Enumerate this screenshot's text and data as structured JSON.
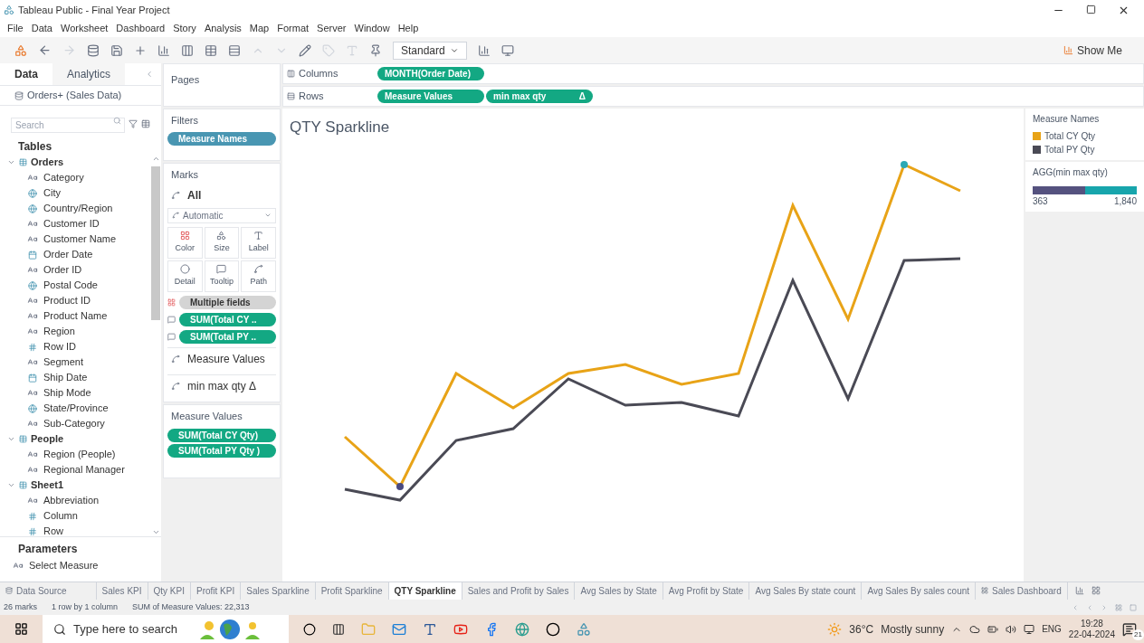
{
  "window": {
    "title": "Tableau Public - Final Year Project"
  },
  "menu": [
    "File",
    "Data",
    "Worksheet",
    "Dashboard",
    "Story",
    "Analysis",
    "Map",
    "Format",
    "Server",
    "Window",
    "Help"
  ],
  "toolbar": {
    "fit": "Standard",
    "show_me": "Show Me"
  },
  "side_tabs": [
    {
      "label": "Data",
      "selected": true
    },
    {
      "label": "Analytics",
      "selected": false
    }
  ],
  "data_source": "Orders+ (Sales Data)",
  "search": {
    "placeholder": "Search"
  },
  "tables_heading": "Tables",
  "tables": [
    {
      "name": "Orders",
      "expanded": true,
      "children": [
        {
          "name": "Category",
          "kind": "text"
        },
        {
          "name": "City",
          "kind": "geo"
        },
        {
          "name": "Country/Region",
          "kind": "geo"
        },
        {
          "name": "Customer ID",
          "kind": "text"
        },
        {
          "name": "Customer Name",
          "kind": "text"
        },
        {
          "name": "Order Date",
          "kind": "date"
        },
        {
          "name": "Order ID",
          "kind": "text"
        },
        {
          "name": "Postal Code",
          "kind": "geo"
        },
        {
          "name": "Product ID",
          "kind": "text"
        },
        {
          "name": "Product Name",
          "kind": "text"
        },
        {
          "name": "Region",
          "kind": "text"
        },
        {
          "name": "Row ID",
          "kind": "number"
        },
        {
          "name": "Segment",
          "kind": "text"
        },
        {
          "name": "Ship Date",
          "kind": "date"
        },
        {
          "name": "Ship Mode",
          "kind": "text"
        },
        {
          "name": "State/Province",
          "kind": "geo"
        },
        {
          "name": "Sub-Category",
          "kind": "text"
        }
      ]
    },
    {
      "name": "People",
      "expanded": true,
      "children": [
        {
          "name": "Region (People)",
          "kind": "text"
        },
        {
          "name": "Regional Manager",
          "kind": "text"
        }
      ]
    },
    {
      "name": "Sheet1",
      "expanded": true,
      "children": [
        {
          "name": "Abbreviation",
          "kind": "text"
        },
        {
          "name": "Column",
          "kind": "number"
        },
        {
          "name": "Row",
          "kind": "number"
        }
      ]
    }
  ],
  "parameters": {
    "heading": "Parameters",
    "items": [
      {
        "name": "Select Measure",
        "kind": "text"
      }
    ]
  },
  "pages": {
    "title": "Pages"
  },
  "filters": {
    "title": "Filters",
    "pills": [
      {
        "label": "Measure Names",
        "kind": "dimension"
      }
    ]
  },
  "marks": {
    "title": "Marks",
    "all": "All",
    "type": "Automatic",
    "buttons": [
      {
        "label": "Color",
        "kind": "color"
      },
      {
        "label": "Size",
        "kind": "size"
      },
      {
        "label": "Label",
        "kind": "label"
      },
      {
        "label": "Detail",
        "kind": "detail"
      },
      {
        "label": "Tooltip",
        "kind": "tooltip"
      },
      {
        "label": "Path",
        "kind": "path"
      }
    ],
    "pills": [
      {
        "label": "Multiple fields",
        "kind": "color"
      },
      {
        "label": "SUM(Total CY ..",
        "kind": "tooltip"
      },
      {
        "label": "SUM(Total PY ..",
        "kind": "tooltip"
      }
    ],
    "layers": [
      "Measure Values",
      "min max qty Δ"
    ]
  },
  "measure_values": {
    "title": "Measure Values",
    "pills": [
      "SUM(Total CY Qty)",
      "SUM(Total PY Qty )"
    ]
  },
  "shelves": [
    {
      "label": "Columns",
      "kind": "columns",
      "pills": [
        {
          "label": "MONTH(Order Date)"
        }
      ]
    },
    {
      "label": "Rows",
      "kind": "rows",
      "pills": [
        {
          "label": "Measure Values"
        },
        {
          "label": "min max qty",
          "delta": "Δ"
        }
      ]
    }
  ],
  "chart": {
    "title": "QTY Sparkline"
  },
  "legend": {
    "title": "Measure Names",
    "items": [
      {
        "label": "Total CY Qty",
        "color": "#e8a317"
      },
      {
        "label": "Total PY Qty",
        "color": "#4a4a55"
      }
    ]
  },
  "range_legend": {
    "title": "AGG(min max qty)",
    "min": "363",
    "max": "1,840"
  },
  "sheet_tabs": [
    {
      "label": "Data Source",
      "kind": "datasource",
      "selected": false
    },
    {
      "label": "Sales KPI",
      "kind": "sheet",
      "selected": false
    },
    {
      "label": "Qty KPI",
      "kind": "sheet",
      "selected": false
    },
    {
      "label": "Profit KPI",
      "kind": "sheet",
      "selected": false
    },
    {
      "label": "Sales Sparkline",
      "kind": "sheet",
      "selected": false
    },
    {
      "label": "Profit Sparkline",
      "kind": "sheet",
      "selected": false
    },
    {
      "label": "QTY Sparkline",
      "kind": "sheet",
      "selected": true
    },
    {
      "label": "Sales and Profit by Sales",
      "kind": "sheet",
      "selected": false
    },
    {
      "label": "Avg Sales by State",
      "kind": "sheet",
      "selected": false
    },
    {
      "label": "Avg Profit by State",
      "kind": "sheet",
      "selected": false
    },
    {
      "label": "Avg Sales By state count",
      "kind": "sheet",
      "selected": false
    },
    {
      "label": "Avg Sales By sales count",
      "kind": "sheet",
      "selected": false
    },
    {
      "label": "Sales Dashboard",
      "kind": "dashboard",
      "selected": false
    }
  ],
  "status_bar": [
    "26 marks",
    "1 row by 1 column",
    "SUM of Measure Values: 22,313"
  ],
  "taskbar": {
    "search_placeholder": "Type here to search",
    "temperature": "36°C",
    "weather": "Mostly sunny",
    "language": "ENG",
    "time": "19:28",
    "date": "22-04-2024",
    "notifications": "21"
  }
}
